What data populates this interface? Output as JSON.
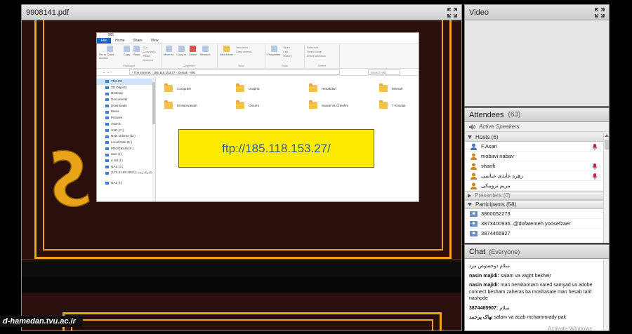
{
  "pdf_pod": {
    "title": "9908141.pdf",
    "explorer": {
      "window_title": "991",
      "tabs": [
        "File",
        "Home",
        "Share",
        "View"
      ],
      "ribbon_groups": [
        {
          "label": "Clipboard",
          "buttons": [
            "Pin to Quick access",
            "Copy",
            "Paste"
          ],
          "small": [
            "Cut",
            "Copy path",
            "Paste shortcut"
          ]
        },
        {
          "label": "Organize",
          "buttons": [
            "Move to",
            "Copy to",
            "Delete",
            "Rename"
          ],
          "small": []
        },
        {
          "label": "New",
          "buttons": [
            "New folder"
          ],
          "small": [
            "New item",
            "Easy access"
          ]
        },
        {
          "label": "Open",
          "buttons": [
            "Properties"
          ],
          "small": [
            "Open",
            "Edit",
            "History"
          ]
        },
        {
          "label": "Select",
          "buttons": [],
          "small": [
            "Select all",
            "Select none",
            "Invert selection"
          ]
        }
      ],
      "address": "›  The internet  ›  185.118.153.27  ›  Zeinab  ›  991",
      "search_placeholder": "Search 991",
      "nav_items": [
        "This PC",
        "3D Objects",
        "Desktop",
        "Documents",
        "Downloads",
        "Music",
        "Pictures",
        "Videos",
        "SSD (C:)",
        "New Volume (D:)",
        "Local Disk (E:)",
        "PROGRAM (F:)",
        "user (I:)",
        "a old (I:)",
        "NAS (J:)",
        "مشترک زینب (\\\\172.21.88.200)",
        "NAS (I:)"
      ],
      "folders_row1": [
        "Computer",
        "Graphic",
        "Hesabdari",
        "Memari"
      ],
      "folders_row2": [
        "M Mamvasiah",
        "Omumi",
        "Sanati Va Gheshm",
        "T Koodak"
      ],
      "ftp_text": "ftp://185.118.153.27/"
    }
  },
  "video_pod": {
    "title": "Video"
  },
  "attendees_pod": {
    "title": "Attendees",
    "count": "(63)",
    "toolbar_label": "Active Speakers",
    "hosts_header": "Hosts (6)",
    "hosts": [
      "F.Asari",
      "mobavi nabav",
      "sharifi",
      "زهره عابدی عباسی",
      "مریم تروبیکی"
    ],
    "presenters_header": "Presenters (0)",
    "participants_header": "Participants (58)",
    "participants": [
      "3860052273",
      "3873400936..@dofatemeh yoosefzaer",
      "3874465927"
    ]
  },
  "chat_pod": {
    "title": "Chat",
    "subtitle": "(Everyone)",
    "messages": [
      {
        "sender": "",
        "text": "سلام دوخصوص مرد"
      },
      {
        "sender": "nasin majidi:",
        "text": " salam va vaght bekheir"
      },
      {
        "sender": "nasin majidi:",
        "text": " man nemitoonam vared samyad va adobe connect besham zaheras ba moshasate man hesab tarif nashode"
      },
      {
        "sender": "3874465907:",
        "text": " سلام"
      },
      {
        "sender": "تهاک پرحمد",
        "text": " salam va acab mchammrady pak"
      }
    ],
    "os_watermark": "Activate Windows"
  },
  "site_watermark": "d-hamedan.tvu.ac.ir",
  "colors": {
    "frame_gold": "#e8a51a",
    "stage_bg": "#2a0f0d",
    "ftp_box": "#ffeb00",
    "ftp_text": "#2f5f8f",
    "explorer_file_tab": "#1a64c4"
  }
}
